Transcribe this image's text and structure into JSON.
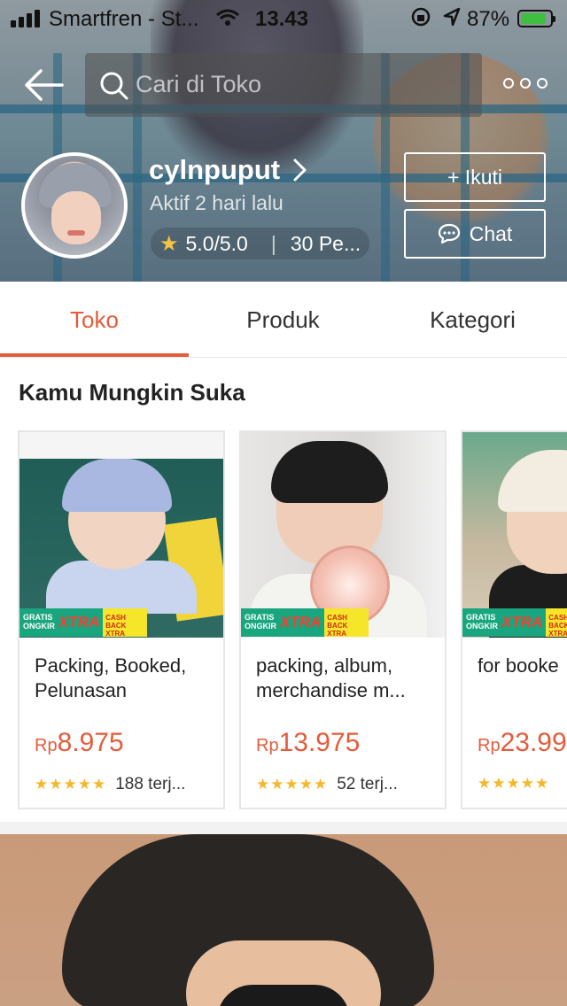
{
  "status_bar": {
    "carrier": "Smartfren - St...",
    "time": "13.43",
    "battery": "87%",
    "battery_level": 0.87
  },
  "header": {
    "search_placeholder": "Cari di Toko",
    "icons": [
      "back-arrow-icon",
      "search-icon",
      "more-icon"
    ]
  },
  "shop": {
    "name": "cylnpuput",
    "last_active": "Aktif 2 hari lalu",
    "rating": "5.0/5.0",
    "products": "30 Pe...",
    "follow_label": "+ Ikuti",
    "chat_label": "Chat"
  },
  "tabs": [
    {
      "label": "Toko",
      "active": true
    },
    {
      "label": "Produk",
      "active": false
    },
    {
      "label": "Kategori",
      "active": false
    }
  ],
  "section": {
    "title": "Kamu Mungkin Suka"
  },
  "products": [
    {
      "name": "Packing, Booked, Pelunasan",
      "currency": "Rp",
      "price": "8.975",
      "rating": 5,
      "sold": "188 terj..."
    },
    {
      "name": "packing, album, merchandise m...",
      "currency": "Rp",
      "price": "13.975",
      "rating": 5,
      "sold": "52 terj..."
    },
    {
      "name": "for booke",
      "currency": "Rp",
      "price": "23.99",
      "rating": 5,
      "sold": ""
    }
  ],
  "badge": {
    "gratis": "GRATIS ONGKIR",
    "xtra": "XTRA",
    "cashback": "CASH BACK XTRA"
  },
  "colors": {
    "accent": "#e55b3b",
    "star": "#f6b72a",
    "badge_green": "#19a67f",
    "badge_yellow": "#f5e62a"
  }
}
